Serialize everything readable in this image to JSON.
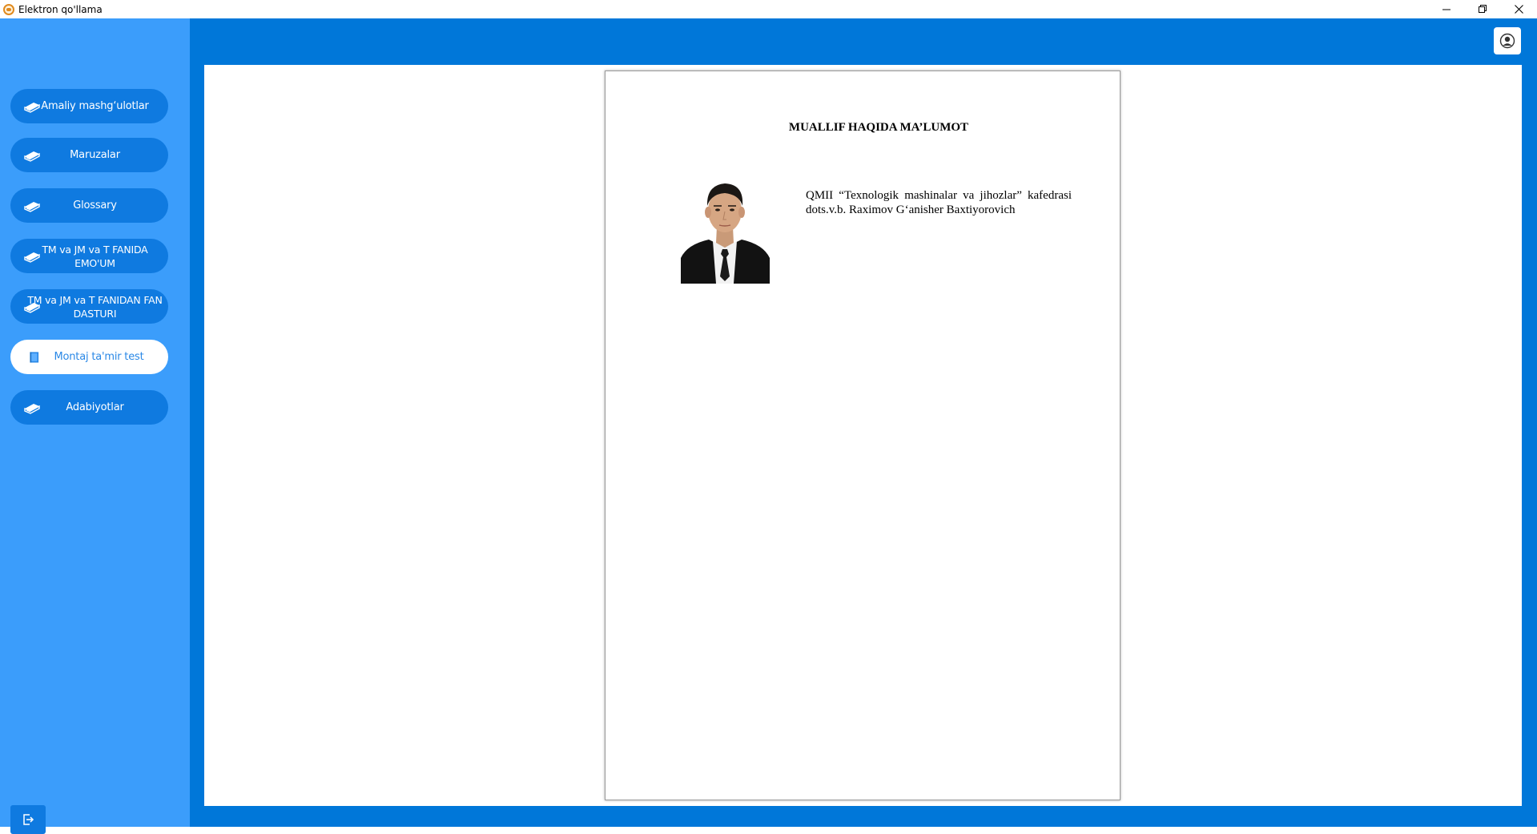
{
  "window": {
    "title": "Elektron qo'llama",
    "controls": [
      "minimize",
      "restore",
      "close"
    ]
  },
  "sidebar": {
    "items": [
      {
        "label": "Amaliy mashg‘ulotlar",
        "icon": "book-icon",
        "active": false
      },
      {
        "label": "Maruzalar",
        "icon": "book-icon",
        "active": false
      },
      {
        "label": "Glossary",
        "icon": "book-icon",
        "active": false
      },
      {
        "label": "TM va JM va T FANIDA EMO'UM",
        "icon": "book-icon",
        "active": false
      },
      {
        "label": "TM va JM va T FANIDAN FAN DASTURI",
        "icon": "book-icon",
        "active": false
      },
      {
        "label": "Montaj ta'mir test",
        "icon": "test-icon",
        "active": true
      },
      {
        "label": "Adabiyotlar",
        "icon": "book-icon",
        "active": false
      }
    ],
    "logout_icon": "logout-icon"
  },
  "header": {
    "user_icon": "user-icon"
  },
  "document": {
    "title": "MUALLIF HAQIDA MA’LUMOT",
    "line1": "QMII “Texnologik mashinalar va jihozlar” kafedrasi",
    "line2": "dots.v.b. Raximov G‘anisher Baxtiyorovich"
  },
  "colors": {
    "sidebar_bg": "#3b9dfb",
    "nav_button": "#0f7ae0",
    "nav_active_bg": "#ffffff",
    "nav_active_text": "#2a88e6",
    "main_bg": "#0077d9"
  }
}
